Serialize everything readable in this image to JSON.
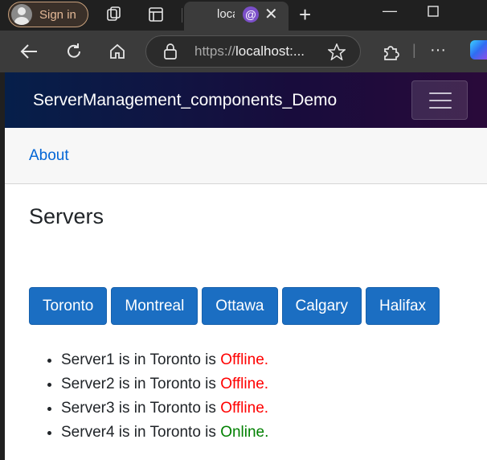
{
  "browser": {
    "signin_label": "Sign in",
    "tab_title": "localhost",
    "url_prefix": "https://",
    "url_host": "localhost:...",
    "icons": [
      "avatar-icon",
      "workspaces-icon",
      "tab-actions-icon",
      "blazor-favicon",
      "close-icon",
      "new-tab-icon",
      "minimize-icon",
      "maximize-icon",
      "back-icon",
      "refresh-icon",
      "home-icon",
      "lock-icon",
      "favorite-star-icon",
      "extensions-icon",
      "more-icon",
      "copilot-icon"
    ]
  },
  "app": {
    "brand": "ServerManagement_components_Demo",
    "nav_link": "About",
    "page_title": "Servers",
    "cities": [
      "Toronto",
      "Montreal",
      "Ottawa",
      "Calgary",
      "Halifax"
    ],
    "servers": [
      {
        "text": "Server1 is in Toronto is ",
        "status": "Offline."
      },
      {
        "text": "Server2 is in Toronto is ",
        "status": "Offline."
      },
      {
        "text": "Server3 is in Toronto is ",
        "status": "Offline."
      },
      {
        "text": "Server4 is in Toronto is ",
        "status": "Online."
      }
    ],
    "colors": {
      "offline": "#ff0000",
      "online": "#008000",
      "button": "#1b6ec2",
      "link": "#0366d6"
    }
  }
}
